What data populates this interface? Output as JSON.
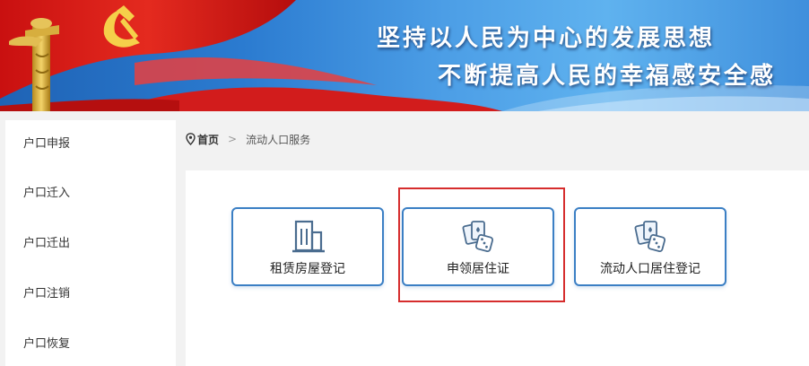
{
  "banner": {
    "slogan_line1": "坚持以人民为中心的发展思想",
    "slogan_line2": "不断提高人民的幸福感安全感",
    "emblem_icon": "party-emblem-icon",
    "column_icon": "huabiao-column-icon"
  },
  "sidebar": {
    "items": [
      {
        "label": "户口申报"
      },
      {
        "label": "户口迁入"
      },
      {
        "label": "户口迁出"
      },
      {
        "label": "户口注销"
      },
      {
        "label": "户口恢复"
      }
    ]
  },
  "breadcrumb": {
    "icon": "location-pin-icon",
    "home": "首页",
    "separator": ">",
    "current": "流动人口服务"
  },
  "services": [
    {
      "label": "租赁房屋登记",
      "icon": "building-icon"
    },
    {
      "label": "申领居住证",
      "icon": "cards-dice-icon"
    },
    {
      "label": "流动人口居住登记",
      "icon": "cards-dice-icon"
    }
  ],
  "colors": {
    "accent_border": "#3b7fc4",
    "highlight": "#d62d2d",
    "banner_red": "#d81e1e",
    "banner_blue": "#2b7bd0"
  }
}
